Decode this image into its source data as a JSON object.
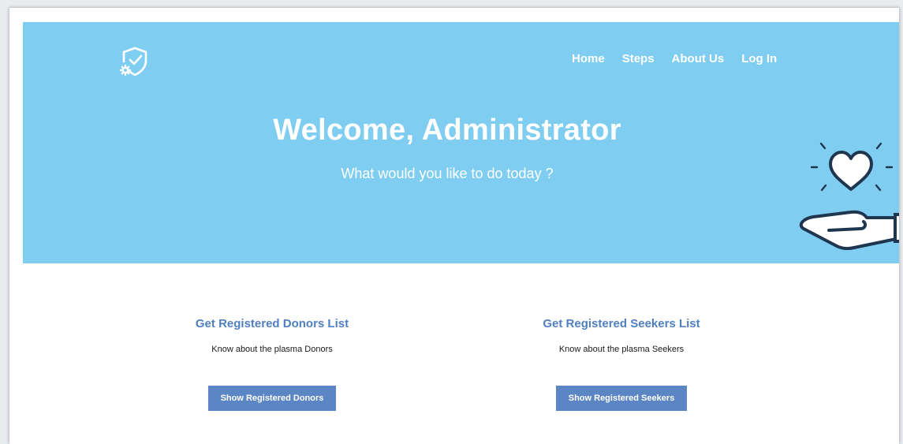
{
  "nav": {
    "items": [
      {
        "label": "Home"
      },
      {
        "label": "Steps"
      },
      {
        "label": "About Us"
      },
      {
        "label": "Log In"
      }
    ]
  },
  "hero": {
    "title": "Welcome, Administrator",
    "subtitle": "What would you like to do today ?"
  },
  "cards": {
    "donors": {
      "title": "Get Registered Donors List",
      "description": "Know about the plasma Donors",
      "button": "Show Registered Donors"
    },
    "seekers": {
      "title": "Get Registered Seekers List",
      "description": "Know about the plasma Seekers",
      "button": "Show Registered Seekers"
    }
  },
  "icons": {
    "logo": "shield-check-gear-icon",
    "illustration": "heart-in-hand-icon"
  },
  "colors": {
    "hero_background": "#7fcef2",
    "card_title": "#4f7fc0",
    "button_background": "#5b85c4",
    "text_white": "#ffffff",
    "illustration_stroke": "#1f3650"
  }
}
